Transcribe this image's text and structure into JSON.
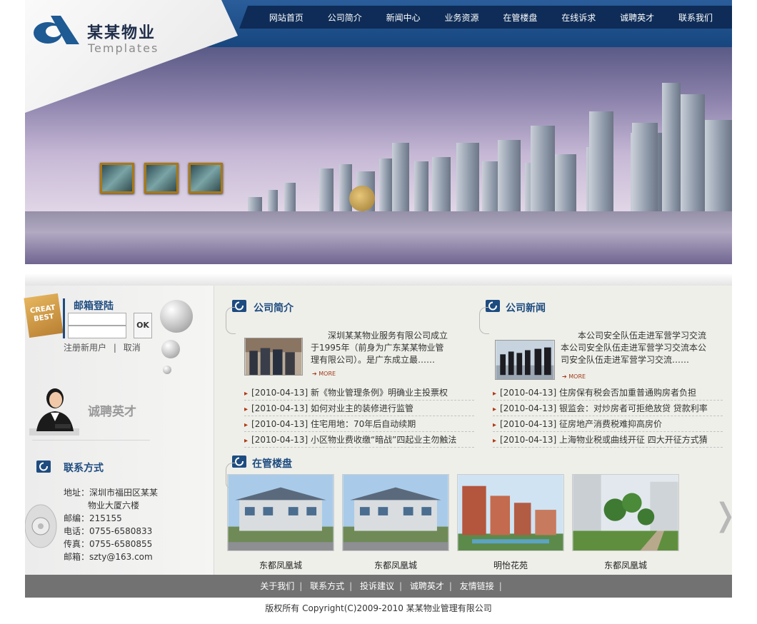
{
  "logo": {
    "title": "某某物业",
    "subtitle": "Templates"
  },
  "nav": [
    "网站首页",
    "公司简介",
    "新闻中心",
    "业务资源",
    "在管楼盘",
    "在线诉求",
    "诚聘英才",
    "联系我们"
  ],
  "sidebar": {
    "sticker": "CREAT BEST",
    "mail_title": "邮箱登陆",
    "ok_label": "OK",
    "register": "注册新用户",
    "sep": "|",
    "cancel": "取消",
    "recruit": "诚聘英才",
    "contact_title": "联系方式",
    "address_1": "地址：深圳市福田区某某",
    "address_2": "物业大厦六楼",
    "postcode": "邮编：215155",
    "phone": "电话：0755-6580833",
    "fax": "传真：0755-6580855",
    "email": "邮箱：szty@163.com"
  },
  "about": {
    "title": "公司简介",
    "text": "深圳某某物业服务有限公司成立于1995年（前身为广东某某物业管理有限公司）。是广东成立最……",
    "more": "MORE",
    "items": [
      "[2010-04-13]  新《物业管理条例》明确业主投票权",
      "[2010-04-13]  如何对业主的装修进行监管",
      "[2010-04-13]  住宅用地：70年后自动续期",
      "[2010-04-13]  小区物业费收缴“暗战”四起业主勿触法"
    ]
  },
  "news": {
    "title": "公司新闻",
    "text": "本公司安全队伍走进军营学习交流本公司安全队伍走进军营学习交流本公司安全队伍走进军营学习交流……",
    "more": "MORE",
    "items": [
      "[2010-04-13]  住房保有税会否加重普通购房者负担",
      "[2010-04-13]  银监会：对炒房者可拒绝放贷 贷款利率",
      "[2010-04-13]  征房地产消费税难抑高房价",
      "[2010-04-13]  上海物业税或曲线开征 四大开征方式猜"
    ]
  },
  "properties": {
    "title": "在管楼盘",
    "items": [
      "东都凤凰城",
      "东都凤凰城",
      "明怡花苑",
      "东都凤凰城"
    ]
  },
  "footer": {
    "links": [
      "关于我们",
      "联系方式",
      "投诉建议",
      "诚聘英才",
      "友情链接"
    ],
    "sep": "|",
    "copyright": "版权所有 Copyright(C)2009-2010 某某物业管理有限公司"
  },
  "colors": {
    "nav_bg": "#0e2c57",
    "header_blue": "#1e4c80",
    "footer_bg": "#727272",
    "bullet": "#b03a17"
  }
}
